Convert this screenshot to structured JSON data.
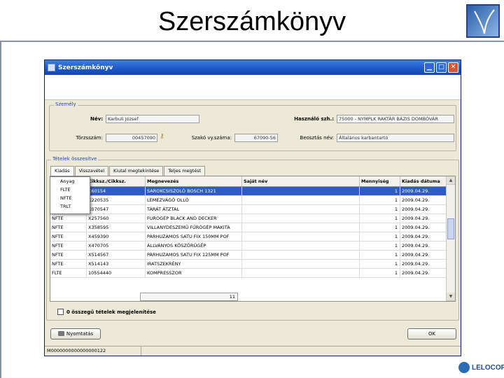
{
  "slide": {
    "title": "Szerszámkönyv",
    "brand": "LELOCOR"
  },
  "window": {
    "title": "Szerszámkönyv"
  },
  "person": {
    "legend": "Személy",
    "name_label": "Név:",
    "name_value": "Karbuli József",
    "id_label": "Törzsszám:",
    "id_value": "00457090",
    "user_label": "Használó szh.:",
    "user_value": "75000 - NYMPLK RAKTÁR BÁZIS DOMBÓVÁR",
    "repair_label": "Szakó vy.száma:",
    "repair_value": "67090-56",
    "role_label": "Beosztás név:",
    "role_value": "Általános karbantartó"
  },
  "items": {
    "legend": "Tételek összesítve",
    "tabs": [
      "Kiadás",
      "Visszavétel",
      "Kiutal megtekintése",
      "Teljes megtést"
    ]
  },
  "table": {
    "columns": [
      "",
      "Cikksz./Cikksz.",
      "Megnevezés",
      "Saját név",
      "Mennyiség",
      "Kiadás dátuma"
    ],
    "rows": [
      [
        "",
        "X60154",
        "SAROKCSISZOLÓ BOSCH 1321",
        "",
        "1",
        "2009.04.29."
      ],
      [
        "",
        "X220535",
        "LEMEZVÁGÓ OLLÓ",
        "",
        "1",
        "2009.04.29."
      ],
      [
        "",
        "X070547",
        "TÁRÁT ÁTZTAL",
        "",
        "1",
        "2009.04.29."
      ],
      [
        "NFTE",
        "X257560",
        "FUROGÉP BLACK AND DECKER",
        "",
        "1",
        "2009.04.29."
      ],
      [
        "NFTE",
        "X358595",
        "VILLANYDESZEMŰ FÚRÓGÉP MAKITA",
        "",
        "1",
        "2009.04.29."
      ],
      [
        "NFTE",
        "X459390",
        "PÁRHUZAMOS SATU FIX 150MM POF",
        "",
        "1",
        "2009.04.29."
      ],
      [
        "NFTE",
        "X470705",
        "ÁLLVÁNYOS KÖSZÖRŰGÉP",
        "",
        "1",
        "2009.04.29."
      ],
      [
        "NFTE",
        "X514567",
        "PÁRHUZAMOS SATU FIX 125MM POF",
        "",
        "1",
        "2009.04.29."
      ],
      [
        "NFTE",
        "X514143",
        "IRATSZEKRÉNY",
        "",
        "1",
        "2009.04.29."
      ],
      [
        "FLTE",
        "10554440",
        "KOMPRESSZOR",
        "",
        "1",
        "2009.04.29."
      ]
    ],
    "total": "11"
  },
  "dropdown": {
    "items": [
      "Anyag",
      "FLTE",
      "NFTE",
      "TRLT"
    ]
  },
  "checkbox_label": "0 összegű tételek megjelenítése",
  "buttons": {
    "print": "Nyomtatás",
    "ok": "OK"
  },
  "status": {
    "cell1": "M0000000000000000122"
  },
  "colors": {
    "title_bar": "#1c56c8",
    "selection": "#2f5cc4",
    "legend_text": "#1f4bb3"
  }
}
